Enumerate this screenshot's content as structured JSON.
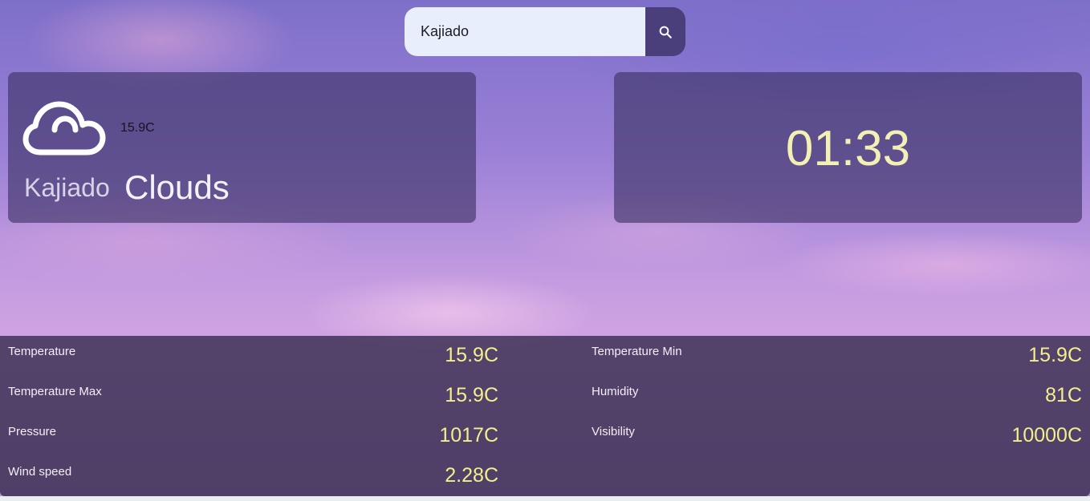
{
  "search": {
    "value": "Kajiado",
    "button_icon": "search-icon"
  },
  "weather": {
    "icon": "cloud-icon",
    "temperature": "15.9C",
    "city": "Kajiado",
    "condition": "Clouds"
  },
  "clock": {
    "time": "01:33"
  },
  "stats": {
    "temperature": {
      "label": "Temperature",
      "value": "15.9C"
    },
    "temperature_min": {
      "label": "Temperature Min",
      "value": "15.9C"
    },
    "temperature_max": {
      "label": "Temperature Max",
      "value": "15.9C"
    },
    "humidity": {
      "label": "Humidity",
      "value": "81C"
    },
    "pressure": {
      "label": "Pressure",
      "value": "1017C"
    },
    "visibility": {
      "label": "Visibility",
      "value": "10000C"
    },
    "wind_speed": {
      "label": "Wind speed",
      "value": "2.28C"
    }
  },
  "colors": {
    "card_bg": "#3a3062",
    "accent_value": "#f2ef8c",
    "clock": "#f3f0b4",
    "search_button": "#4a3f7a",
    "search_input_bg": "#e8eefc"
  }
}
